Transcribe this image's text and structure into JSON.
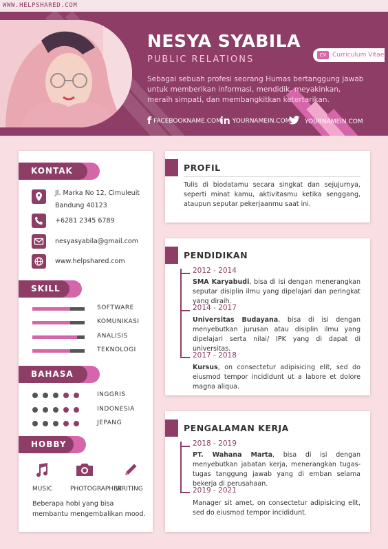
{
  "site": "WWW.HELPSHARED.COM",
  "header": {
    "name": "NESYA SYABILA",
    "role": "PUBLIC RELATIONS",
    "badge_tag": "CV",
    "badge_label": "Curriculum Vitae",
    "intro": "Sebagai sebuah profesi seorang Humas bertanggung jawab untuk memberikan informasi, mendidik, meyakinkan, meraih simpati, dan membangkitkan ketertarikan.",
    "socials": [
      {
        "icon": "facebook-icon",
        "glyph": "f",
        "text": "FACEBOOKNAME.COM"
      },
      {
        "icon": "linkedin-icon",
        "glyph": "in",
        "text": "YOURNAMEIN.COM"
      },
      {
        "icon": "twitter-icon",
        "glyph": "",
        "text": "YOURNAMEIN.COM"
      }
    ]
  },
  "contact": {
    "title": "KONTAK",
    "address_line1": "Jl. Marka No 12, Cimuleuit",
    "address_line2": "Bandung 40123",
    "phone": "+6281 2345 6789",
    "email": "nesyasyabila@gmail.com",
    "website": "www.helpshared.com"
  },
  "skill": {
    "title": "SKILL",
    "items": [
      {
        "label": "SOFTWARE",
        "level": 0.72
      },
      {
        "label": "KOMUNIKASI",
        "level": 0.72
      },
      {
        "label": "ANALISIS",
        "level": 0.86
      },
      {
        "label": "TEKNOLOGI",
        "level": 0.72
      }
    ]
  },
  "bahasa": {
    "title": "BAHASA",
    "items": [
      {
        "label": "INGGRIS",
        "level": 5
      },
      {
        "label": "INDONESIA",
        "level": 5
      },
      {
        "label": "JEPANG",
        "level": 5
      }
    ],
    "max": 5
  },
  "hobby": {
    "title": "HOBBY",
    "items": [
      {
        "label": "MUSIC",
        "icon": "music-note-icon"
      },
      {
        "label": "PHOTOGRAPHER",
        "icon": "camera-icon"
      },
      {
        "label": "WRITING",
        "icon": "pencil-icon"
      }
    ],
    "description": "Beberapa hobi yang bisa membantu mengembalikan mood."
  },
  "profil": {
    "title": "PROFIL",
    "text": "Tulis di biodatamu secara singkat dan sejujurnya, seperti minat kamu, aktivitasmu ketika senggang, ataupun seputar pekerjaanmu saat ini."
  },
  "pendidikan": {
    "title": "PENDIDIKAN",
    "items": [
      {
        "years": "2012 - 2014",
        "org": "SMA Karyabudi",
        "text": ", bisa di isi dengan menerangkan seputar disiplin ilmu yang dipelajari dan peringkat yang diraih."
      },
      {
        "years": "2014 - 2017",
        "org": "Universitas Budayana",
        "text": ", bisa di isi dengan menyebutkan jurusan atau disiplin ilmu yang dipelajari serta nilai/ IPK yang di dapat di universitas."
      },
      {
        "years": "2017 - 2018",
        "org": "Kursus",
        "text": ", on consectetur adipisicing elit, sed do eiusmod tempor incididunt ut a labore et dolore magna aliqua."
      }
    ]
  },
  "pengalaman": {
    "title": "PENGALAMAN KERJA",
    "items": [
      {
        "years": "2018 - 2019",
        "org": "PT. Wahana Marta",
        "text": ", bisa di isi dengan menyebutkan jabatan kerja, menerangkan tugas-tugas tanggung jawab yang di emban selama bekerja di perusahaan."
      },
      {
        "years": "2019 - 2021",
        "org": "",
        "text": "Manager sit amet, on consectetur adipisicing elit, sed do eiusmod tempor incididunt."
      }
    ]
  },
  "colors": {
    "primary": "#8d3d66",
    "accent": "#d466a9",
    "background": "#f9dfe4"
  }
}
